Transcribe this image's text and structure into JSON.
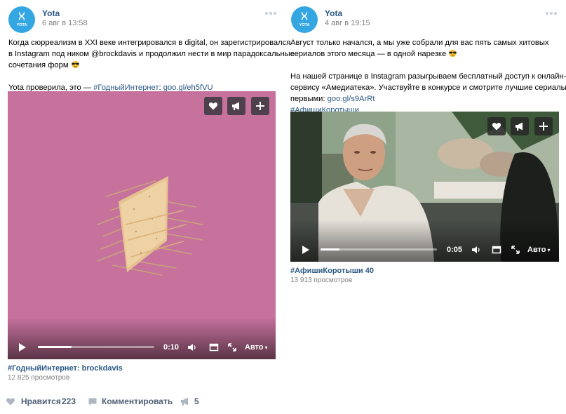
{
  "posts": [
    {
      "author": "Yota",
      "date": "6 авг в 13:58",
      "avatar_label": "YOTA",
      "text_lines": [
        "Когда сюрреализм в XXI веке интегрировался в digital, он зарегистрировался",
        "в Instagram под ником @brockdavis и продолжил нести в мир парадоксальные",
        "сочетания форм"
      ],
      "line2_prefix": "Yota проверила, это — ",
      "hashtag_inline": "#ГодныйИнтернет",
      "link_text": "goo.gl/eh5fVU",
      "video": {
        "time": "0:10",
        "progress": 0.29,
        "quality": "Авто"
      },
      "caption": "#ГодныйИнтернет: brockdavis",
      "views": "12 825 просмотров"
    },
    {
      "author": "Yota",
      "date": "4 авг в 19:15",
      "avatar_label": "YOTA",
      "text_lines": [
        "Август только начался, а мы уже собрали для вас пять самых хитовых",
        "сериалов этого месяца — в одной нарезке"
      ],
      "paragraph2": [
        "На нашей странице в Instagram разыгрываем бесплатный доступ к онлайн-",
        "сервису «Амедиатека». Участвуйте в конкурсе и смотрите лучшие сериалы"
      ],
      "line_prefix": "первыми: ",
      "link_text": "goo.gl/s9ArRt",
      "hashtag": "#АфишиКоротыши",
      "video": {
        "time": "0:05",
        "progress": 0.16,
        "quality": "Авто"
      },
      "caption": "#АфишиКоротыши 40",
      "views": "13 913 просмотров"
    }
  ],
  "actions": {
    "like_label": "Нравится",
    "like_count": "223",
    "comment_label": "Комментировать",
    "share_count": "5"
  },
  "icons": {
    "like": "heart-icon",
    "comment": "comment-icon",
    "share": "megaphone-icon",
    "add": "plus-icon",
    "play": "play-icon",
    "volume": "volume-icon",
    "pip": "picture-in-picture-icon",
    "fullscreen": "fullscreen-icon",
    "more": "more-dots-icon"
  },
  "colors": {
    "link": "#2a5885",
    "avatar": "#34a7e3",
    "muted": "#828282"
  }
}
